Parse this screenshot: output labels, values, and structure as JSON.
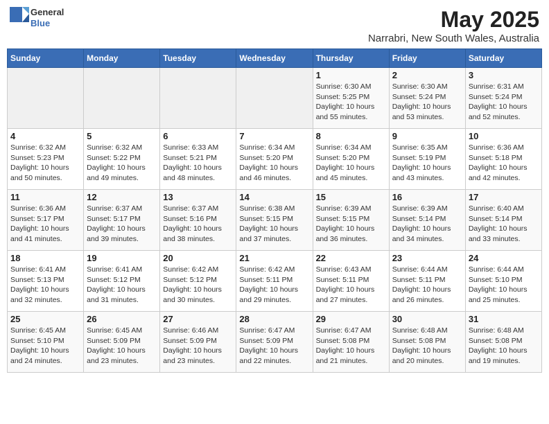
{
  "header": {
    "logo": {
      "line1": "General",
      "line2": "Blue"
    },
    "title": "May 2025",
    "subtitle": "Narrabri, New South Wales, Australia"
  },
  "weekdays": [
    "Sunday",
    "Monday",
    "Tuesday",
    "Wednesday",
    "Thursday",
    "Friday",
    "Saturday"
  ],
  "weeks": [
    [
      {
        "day": "",
        "info": ""
      },
      {
        "day": "",
        "info": ""
      },
      {
        "day": "",
        "info": ""
      },
      {
        "day": "",
        "info": ""
      },
      {
        "day": "1",
        "info": "Sunrise: 6:30 AM\nSunset: 5:25 PM\nDaylight: 10 hours\nand 55 minutes."
      },
      {
        "day": "2",
        "info": "Sunrise: 6:30 AM\nSunset: 5:24 PM\nDaylight: 10 hours\nand 53 minutes."
      },
      {
        "day": "3",
        "info": "Sunrise: 6:31 AM\nSunset: 5:24 PM\nDaylight: 10 hours\nand 52 minutes."
      }
    ],
    [
      {
        "day": "4",
        "info": "Sunrise: 6:32 AM\nSunset: 5:23 PM\nDaylight: 10 hours\nand 50 minutes."
      },
      {
        "day": "5",
        "info": "Sunrise: 6:32 AM\nSunset: 5:22 PM\nDaylight: 10 hours\nand 49 minutes."
      },
      {
        "day": "6",
        "info": "Sunrise: 6:33 AM\nSunset: 5:21 PM\nDaylight: 10 hours\nand 48 minutes."
      },
      {
        "day": "7",
        "info": "Sunrise: 6:34 AM\nSunset: 5:20 PM\nDaylight: 10 hours\nand 46 minutes."
      },
      {
        "day": "8",
        "info": "Sunrise: 6:34 AM\nSunset: 5:20 PM\nDaylight: 10 hours\nand 45 minutes."
      },
      {
        "day": "9",
        "info": "Sunrise: 6:35 AM\nSunset: 5:19 PM\nDaylight: 10 hours\nand 43 minutes."
      },
      {
        "day": "10",
        "info": "Sunrise: 6:36 AM\nSunset: 5:18 PM\nDaylight: 10 hours\nand 42 minutes."
      }
    ],
    [
      {
        "day": "11",
        "info": "Sunrise: 6:36 AM\nSunset: 5:17 PM\nDaylight: 10 hours\nand 41 minutes."
      },
      {
        "day": "12",
        "info": "Sunrise: 6:37 AM\nSunset: 5:17 PM\nDaylight: 10 hours\nand 39 minutes."
      },
      {
        "day": "13",
        "info": "Sunrise: 6:37 AM\nSunset: 5:16 PM\nDaylight: 10 hours\nand 38 minutes."
      },
      {
        "day": "14",
        "info": "Sunrise: 6:38 AM\nSunset: 5:15 PM\nDaylight: 10 hours\nand 37 minutes."
      },
      {
        "day": "15",
        "info": "Sunrise: 6:39 AM\nSunset: 5:15 PM\nDaylight: 10 hours\nand 36 minutes."
      },
      {
        "day": "16",
        "info": "Sunrise: 6:39 AM\nSunset: 5:14 PM\nDaylight: 10 hours\nand 34 minutes."
      },
      {
        "day": "17",
        "info": "Sunrise: 6:40 AM\nSunset: 5:14 PM\nDaylight: 10 hours\nand 33 minutes."
      }
    ],
    [
      {
        "day": "18",
        "info": "Sunrise: 6:41 AM\nSunset: 5:13 PM\nDaylight: 10 hours\nand 32 minutes."
      },
      {
        "day": "19",
        "info": "Sunrise: 6:41 AM\nSunset: 5:12 PM\nDaylight: 10 hours\nand 31 minutes."
      },
      {
        "day": "20",
        "info": "Sunrise: 6:42 AM\nSunset: 5:12 PM\nDaylight: 10 hours\nand 30 minutes."
      },
      {
        "day": "21",
        "info": "Sunrise: 6:42 AM\nSunset: 5:11 PM\nDaylight: 10 hours\nand 29 minutes."
      },
      {
        "day": "22",
        "info": "Sunrise: 6:43 AM\nSunset: 5:11 PM\nDaylight: 10 hours\nand 27 minutes."
      },
      {
        "day": "23",
        "info": "Sunrise: 6:44 AM\nSunset: 5:11 PM\nDaylight: 10 hours\nand 26 minutes."
      },
      {
        "day": "24",
        "info": "Sunrise: 6:44 AM\nSunset: 5:10 PM\nDaylight: 10 hours\nand 25 minutes."
      }
    ],
    [
      {
        "day": "25",
        "info": "Sunrise: 6:45 AM\nSunset: 5:10 PM\nDaylight: 10 hours\nand 24 minutes."
      },
      {
        "day": "26",
        "info": "Sunrise: 6:45 AM\nSunset: 5:09 PM\nDaylight: 10 hours\nand 23 minutes."
      },
      {
        "day": "27",
        "info": "Sunrise: 6:46 AM\nSunset: 5:09 PM\nDaylight: 10 hours\nand 23 minutes."
      },
      {
        "day": "28",
        "info": "Sunrise: 6:47 AM\nSunset: 5:09 PM\nDaylight: 10 hours\nand 22 minutes."
      },
      {
        "day": "29",
        "info": "Sunrise: 6:47 AM\nSunset: 5:08 PM\nDaylight: 10 hours\nand 21 minutes."
      },
      {
        "day": "30",
        "info": "Sunrise: 6:48 AM\nSunset: 5:08 PM\nDaylight: 10 hours\nand 20 minutes."
      },
      {
        "day": "31",
        "info": "Sunrise: 6:48 AM\nSunset: 5:08 PM\nDaylight: 10 hours\nand 19 minutes."
      }
    ]
  ]
}
